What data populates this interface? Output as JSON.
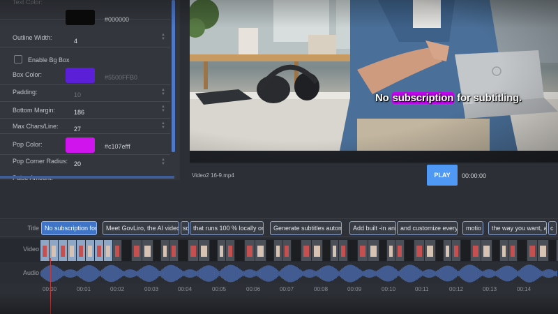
{
  "settings": {
    "text_color": {
      "label": "Text Color:",
      "hex": "#000000",
      "swatch": "#0b0b0b"
    },
    "outline_width": {
      "label": "Outline Width:",
      "value": "4"
    },
    "enable_bg_box": {
      "label": "Enable Bg Box",
      "checked": false
    },
    "box_color": {
      "label": "Box Color:",
      "hex": "#5500FFB0",
      "swatch": "#5a1fd6"
    },
    "padding": {
      "label": "Padding:",
      "value": "10"
    },
    "bottom_margin": {
      "label": "Bottom Margin:",
      "value": "186"
    },
    "max_chars": {
      "label": "Max Chars/Line:",
      "value": "27"
    },
    "pop_color": {
      "label": "Pop Color:",
      "hex": "#c107efff",
      "swatch": "#d014ee"
    },
    "pop_corner_radius": {
      "label": "Pop Corner Radius:",
      "value": "20"
    },
    "pulse_amount": {
      "label": "Pulse Amount:"
    }
  },
  "preview": {
    "subtitle_pre": "No ",
    "subtitle_highlight": "subscription",
    "subtitle_post": " for subtitling.",
    "highlight_color": "#c107ef"
  },
  "player": {
    "filename": "Video2 16-9.mp4",
    "play_label": "PLAY",
    "timecode": "00:00:00"
  },
  "timeline": {
    "title_label": "Title",
    "video_label": "Video",
    "audio_label": "Audio",
    "clips": [
      "No subscription for",
      "Meet GovLiro, the AI video",
      "so",
      "that runs 100 % locally on",
      "Generate subtitles autom",
      "Add built -in ani",
      "and customize every",
      "motio",
      "the way you want, al",
      "c"
    ],
    "ruler": [
      "00:00",
      "00:01",
      "00:02",
      "00:03",
      "00:04",
      "00:05",
      "00:06",
      "00:07",
      "00:08",
      "00:09",
      "00:10",
      "00:11",
      "00:12",
      "00:13",
      "00:14"
    ]
  },
  "colors": {
    "accent": "#4f98f3",
    "clip_active": "#3f74c6",
    "waveform": "#4d6fb8",
    "playhead": "#c23a3a"
  }
}
